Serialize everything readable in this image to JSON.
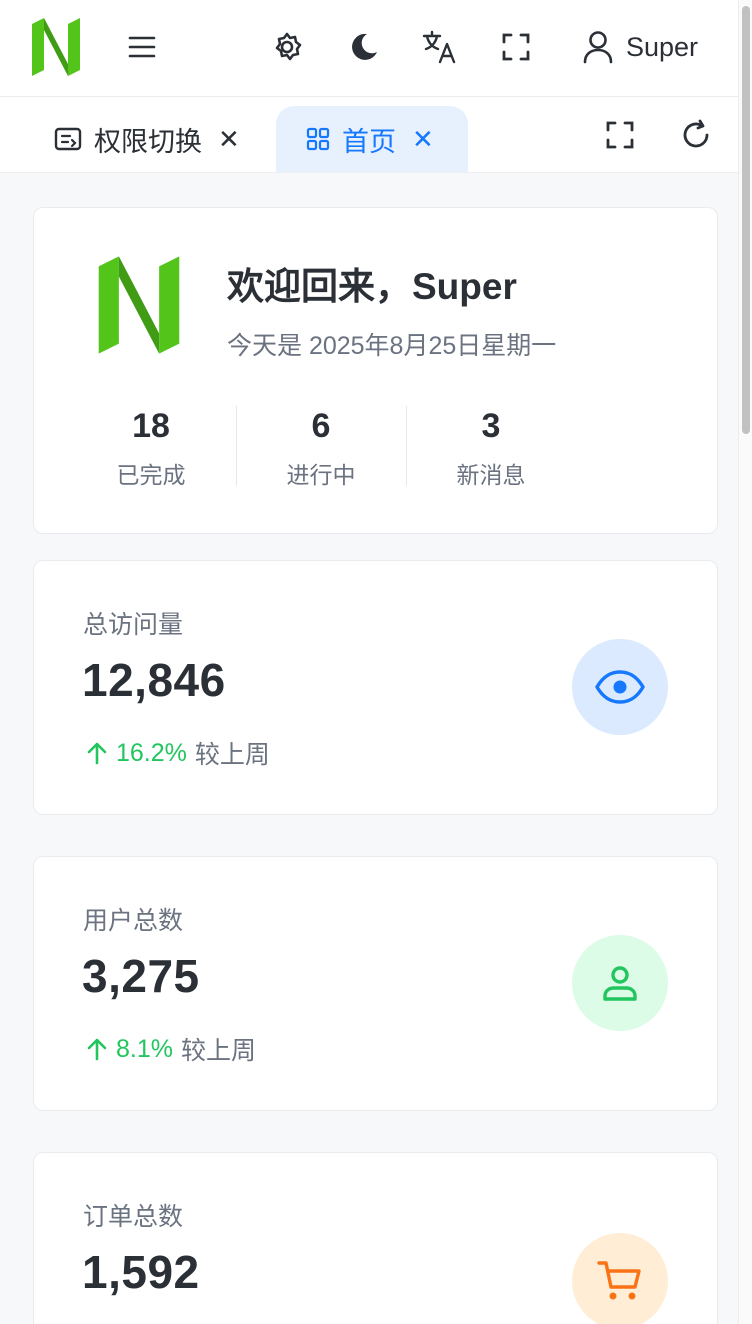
{
  "header": {
    "user_name": "Super"
  },
  "tabs": [
    {
      "label": "权限切换"
    },
    {
      "label": "首页"
    }
  ],
  "welcome": {
    "title": "欢迎回来，Super",
    "date": "今天是 2025年8月25日星期一",
    "stats": [
      {
        "value": "18",
        "label": "已完成"
      },
      {
        "value": "6",
        "label": "进行中"
      },
      {
        "value": "3",
        "label": "新消息"
      }
    ]
  },
  "metrics": [
    {
      "label": "总访问量",
      "value": "12,846",
      "trend": "16.2%",
      "trend_text": "较上周",
      "icon": "eye-icon",
      "color": "#1677ff",
      "bg": "#dbeafe"
    },
    {
      "label": "用户总数",
      "value": "3,275",
      "trend": "8.1%",
      "trend_text": "较上周",
      "icon": "user-icon",
      "color": "#22c55e",
      "bg": "#dcfce7"
    },
    {
      "label": "订单总数",
      "value": "1,592",
      "icon": "cart-icon",
      "color": "#f97316",
      "bg": "#ffedd5"
    }
  ],
  "colors": {
    "brand_green": "#52c41a",
    "accent_blue": "#1677ff",
    "trend_up": "#22c55e"
  }
}
